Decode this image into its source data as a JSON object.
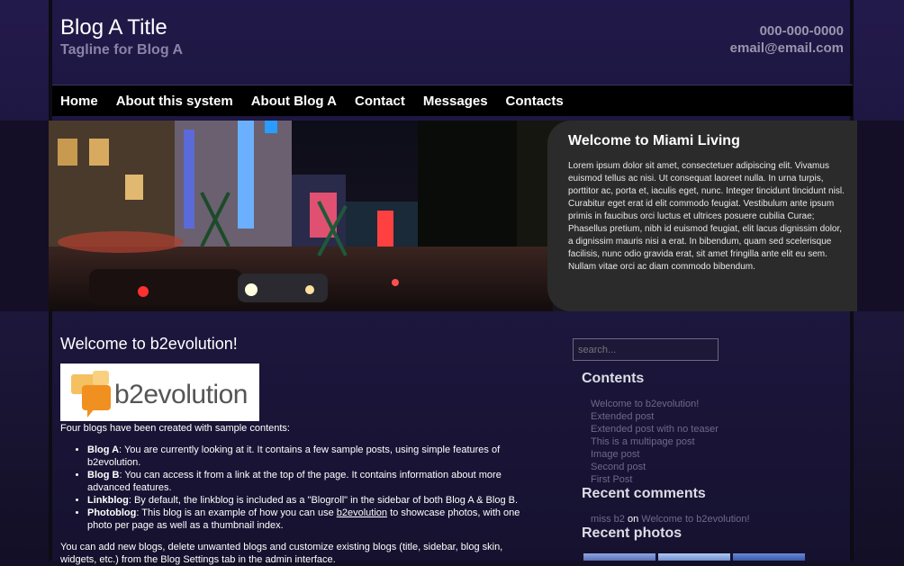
{
  "header": {
    "blog_title": "Blog A Title",
    "tagline": "Tagline for Blog A",
    "phone": "000-000-0000",
    "email": "email@email.com"
  },
  "nav": {
    "items": [
      "Home",
      "About this system",
      "About Blog A",
      "Contact",
      "Messages",
      "Contacts"
    ]
  },
  "hero": {
    "heading": "Welcome to Miami Living",
    "body": "Lorem ipsum dolor sit amet, consectetuer adipiscing elit. Vivamus euismod tellus ac nisi. Ut consequat laoreet nulla. In urna turpis, porttitor ac, porta et, iaculis eget, nunc. Integer tincidunt tincidunt nisl. Curabitur eget erat id elit commodo feugiat. Vestibulum ante ipsum primis in faucibus orci luctus et ultrices posuere cubilia Curae; Phasellus pretium, nibh id euismod feugiat, elit lacus dignissim dolor, a dignissim mauris nisi a erat. In bibendum, quam sed scelerisque facilisis, nunc odio gravida erat, sit amet fringilla ante elit eu sem. Nullam vitae orci ac diam commodo bibendum."
  },
  "post": {
    "title": "Welcome to b2evolution!",
    "logo_text": "b2evolution",
    "intro": "Four blogs have been created with sample contents:",
    "items": [
      {
        "name": "Blog A",
        "text": ": You are currently looking at it. It contains a few sample posts, using simple features of b2evolution."
      },
      {
        "name": "Blog B",
        "text": ": You can access it from a link at the top of the page. It contains information about more advanced features."
      },
      {
        "name": "Linkblog",
        "text": ": By default, the linkblog is included as a \"Blogroll\" in the sidebar of both Blog A & Blog B."
      },
      {
        "name": "Photoblog",
        "text_before": ": This blog is an example of how you can use ",
        "link": "b2evolution",
        "text_after": " to showcase photos, with one photo per page as well as a thumbnail index."
      }
    ],
    "outro": "You can add new blogs, delete unwanted blogs and customize existing blogs (title, sidebar, blog skin, widgets, etc.) from the Blog Settings tab in the admin interface."
  },
  "sidebar": {
    "search_placeholder": "search...",
    "contents_heading": "Contents",
    "contents_items": [
      "Welcome to b2evolution!",
      "Extended post",
      "Extended post with no teaser",
      "This is a multipage post",
      "Image post",
      "Second post",
      "First Post"
    ],
    "comments_heading": "Recent comments",
    "comment_author": "miss b2",
    "comment_on": "on",
    "comment_post": "Welcome to b2evolution!",
    "photos_heading": "Recent photos"
  },
  "colors": {
    "header_bg": "#231a4c",
    "nav_bg": "#000000",
    "welcome_box_bg": "#2b2b2b",
    "muted_link": "#6f6a88"
  }
}
